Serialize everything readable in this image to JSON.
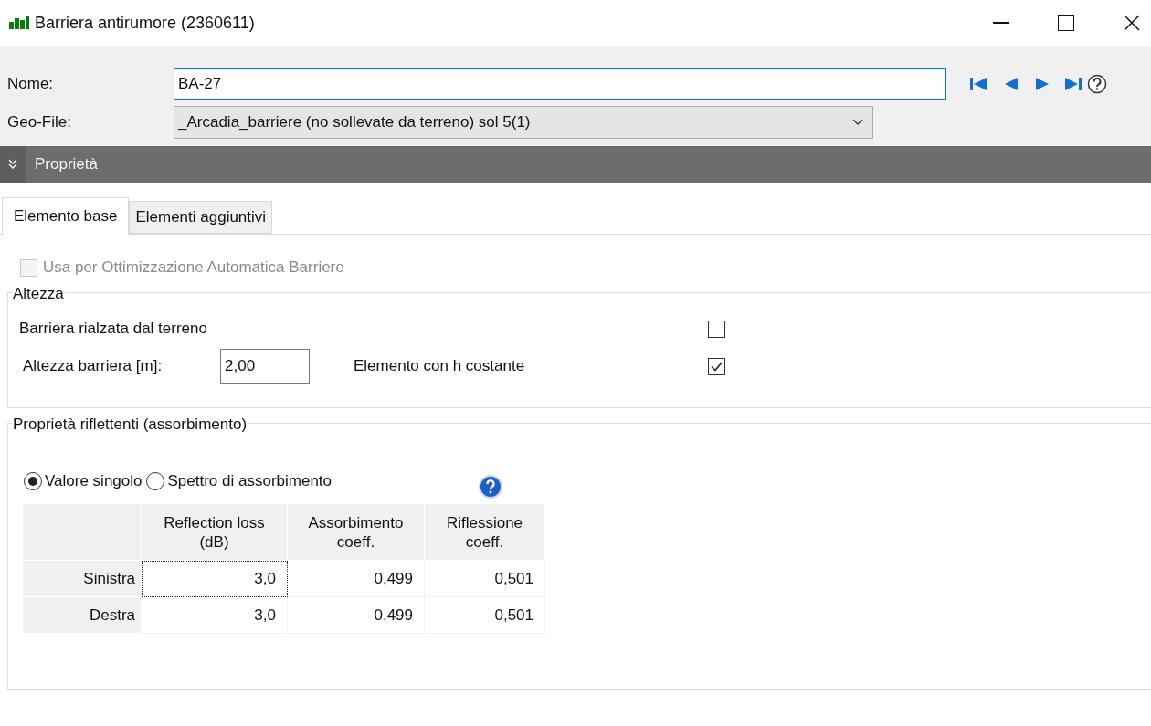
{
  "window": {
    "title": "Barriera antirumore (2360611)"
  },
  "name_field": {
    "label": "Nome:",
    "value": "BA-27"
  },
  "geo_file": {
    "label": "Geo-File:",
    "value": "_Arcadia_barriere (no sollevate da terreno) sol 5(1)"
  },
  "section": {
    "title": "Proprietà",
    "expanded": true
  },
  "tabs": [
    {
      "label": "Elemento base",
      "selected": true
    },
    {
      "label": "Elementi aggiuntivi",
      "selected": false
    }
  ],
  "auto_optimization": {
    "label": "Usa per Ottimizzazione Automatica Barriere",
    "checked": false,
    "disabled": true
  },
  "height_group": {
    "title": "Altezza",
    "raised": {
      "label": "Barriera rialzata dal terreno",
      "checked": false
    },
    "height": {
      "label": "Altezza barriera [m]:",
      "value": "2,00"
    },
    "constant": {
      "label": "Elemento con h costante",
      "checked": true
    }
  },
  "reflective_group": {
    "title": "Proprietà riflettenti (assorbimento)",
    "modes": [
      {
        "label": "Valore singolo",
        "selected": true
      },
      {
        "label": "Spettro di assorbimento",
        "selected": false
      }
    ],
    "table": {
      "columns": [
        "Reflection loss (dB)",
        "Assorbimento coeff.",
        "Riflessione coeff."
      ],
      "rows": [
        {
          "label": "Sinistra",
          "cells": [
            "3,0",
            "0,499",
            "0,501"
          ],
          "focused": true
        },
        {
          "label": "Destra",
          "cells": [
            "3,0",
            "0,499",
            "0,501"
          ],
          "focused": false
        }
      ]
    }
  }
}
